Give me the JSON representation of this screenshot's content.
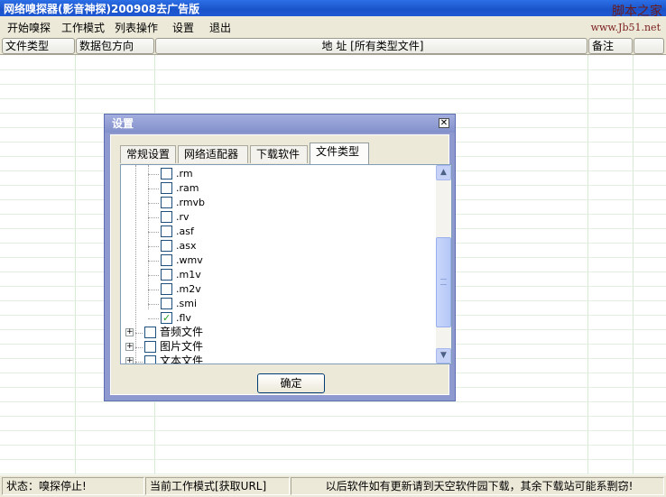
{
  "window": {
    "title": "网络嗅探器(影音神探)200908去广告版",
    "watermark": "脚本之家",
    "watermark_url": "www.Jb51.net"
  },
  "menu": [
    "开始嗅探",
    "工作模式",
    "列表操作",
    "设置",
    "退出"
  ],
  "list": {
    "columns": [
      "文件类型",
      "数据包方向",
      "地    址 [所有类型文件]",
      "备注",
      ""
    ]
  },
  "status": {
    "state": "状态：嗅探停止!",
    "mode": "当前工作模式[获取URL]",
    "message": "以后软件如有更新请到天空软件园下载，其余下载站可能系剽窃!"
  },
  "dialog": {
    "title": "设置",
    "close_symbol": "✕",
    "tabs": [
      "常规设置",
      "网络适配器",
      "下载软件",
      "文件类型"
    ],
    "active_tab": "文件类型",
    "tree": [
      {
        "label": ".rm",
        "checked": false,
        "level": 2
      },
      {
        "label": ".ram",
        "checked": false,
        "level": 2
      },
      {
        "label": ".rmvb",
        "checked": false,
        "level": 2
      },
      {
        "label": ".rv",
        "checked": false,
        "level": 2
      },
      {
        "label": ".asf",
        "checked": false,
        "level": 2
      },
      {
        "label": ".asx",
        "checked": false,
        "level": 2
      },
      {
        "label": ".wmv",
        "checked": false,
        "level": 2
      },
      {
        "label": ".m1v",
        "checked": false,
        "level": 2
      },
      {
        "label": ".m2v",
        "checked": false,
        "level": 2
      },
      {
        "label": ".smi",
        "checked": false,
        "level": 2
      },
      {
        "label": ".flv",
        "checked": true,
        "level": 2
      },
      {
        "label": "音频文件",
        "checked": false,
        "level": 1,
        "expander": "+"
      },
      {
        "label": "图片文件",
        "checked": false,
        "level": 1,
        "expander": "+"
      },
      {
        "label": "文本文件",
        "checked": false,
        "level": 1,
        "expander": "+"
      }
    ],
    "ok_label": "确定"
  },
  "colors": {
    "titlebar": "#1f58d4",
    "dialog_frame": "#8d99cf",
    "grid_line": "#d6ead4"
  }
}
